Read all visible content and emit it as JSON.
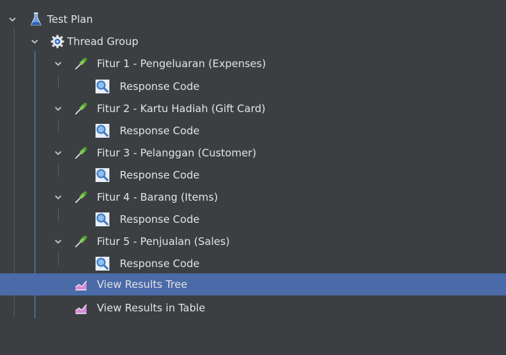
{
  "tree": {
    "root": {
      "label": "Test Plan",
      "icon": "flask-icon"
    },
    "thread_group": {
      "label": "Thread Group",
      "icon": "gear-icon"
    },
    "features": [
      {
        "label": "Fitur 1 - Pengeluaran (Expenses)",
        "child": "Response Code"
      },
      {
        "label": "Fitur 2 - Kartu Hadiah (Gift Card)",
        "child": "Response Code"
      },
      {
        "label": "Fitur 3 - Pelanggan (Customer)",
        "child": "Response Code"
      },
      {
        "label": "Fitur 4 - Barang (Items)",
        "child": "Response Code"
      },
      {
        "label": "Fitur 5 - Penjualan (Sales)",
        "child": "Response Code"
      }
    ],
    "listeners": [
      {
        "label": "View Results Tree",
        "selected": true
      },
      {
        "label": "View Results in Table",
        "selected": false
      }
    ]
  },
  "colors": {
    "background": "#3c3f41",
    "selection": "#4a6aa8",
    "text": "#e3e3e3",
    "guide_line": "#4d8ad6"
  }
}
